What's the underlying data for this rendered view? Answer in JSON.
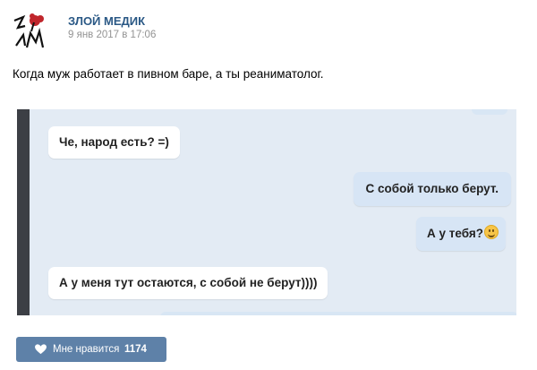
{
  "post": {
    "author": "ЗЛОЙ МЕДИК",
    "date": "9 янв 2017 в 17:06",
    "text": "Когда муж работает в пивном баре, а ты реаниматолог.",
    "avatar_logo_text": "ЗЛМ"
  },
  "chat": {
    "messages": [
      {
        "direction": "incoming",
        "text": "Че, народ есть? =)"
      },
      {
        "direction": "outgoing",
        "text": "С собой только берут."
      },
      {
        "direction": "outgoing",
        "text": "А у тебя?",
        "emoji": "smile-emoji"
      },
      {
        "direction": "incoming",
        "text": "А у меня тут остаются, с собой не берут))))"
      }
    ]
  },
  "like": {
    "label": "Мне нравится",
    "count": "1174",
    "icon": "heart-icon"
  },
  "colors": {
    "author_link": "#2a5885",
    "like_button": "#5e81a8",
    "chat_background": "#e3ebf4",
    "outgoing_bubble": "#d7e5f5",
    "avatar_accent": "#c0262c"
  }
}
